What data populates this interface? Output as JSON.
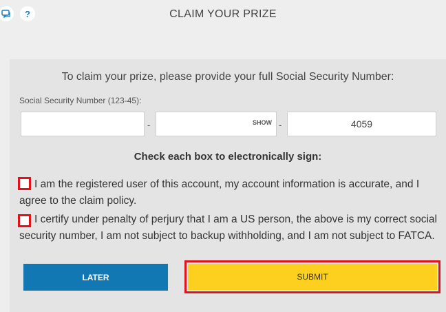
{
  "header": {
    "title": "CLAIM YOUR PRIZE",
    "icons": [
      "chat-icon",
      "help-icon"
    ],
    "help_glyph": "?"
  },
  "form": {
    "prompt": "To claim your prize, please provide your full Social Security Number:",
    "ssn_label": "Social Security Number (123-45):",
    "ssn_part1_value": "",
    "ssn_part2_value": "",
    "ssn_part2_show_label": "SHOW",
    "ssn_part3_value": "4059",
    "separator": "-",
    "check_heading": "Check each box to electronically sign:",
    "checkbox1_text": "I am the registered user of this account, my account information is accurate, and I agree to the claim policy.",
    "checkbox2_text": "I certify under penalty of perjury that I am a US person, the above is my correct social security number, I am not subject to backup withholding, and I am not subject to FATCA.",
    "checkbox1_checked": false,
    "checkbox2_checked": false
  },
  "buttons": {
    "later_label": "LATER",
    "submit_label": "SUBMIT"
  },
  "colors": {
    "later_bg": "#1278b4",
    "submit_bg": "#fdd01f",
    "highlight": "#e0121b"
  }
}
